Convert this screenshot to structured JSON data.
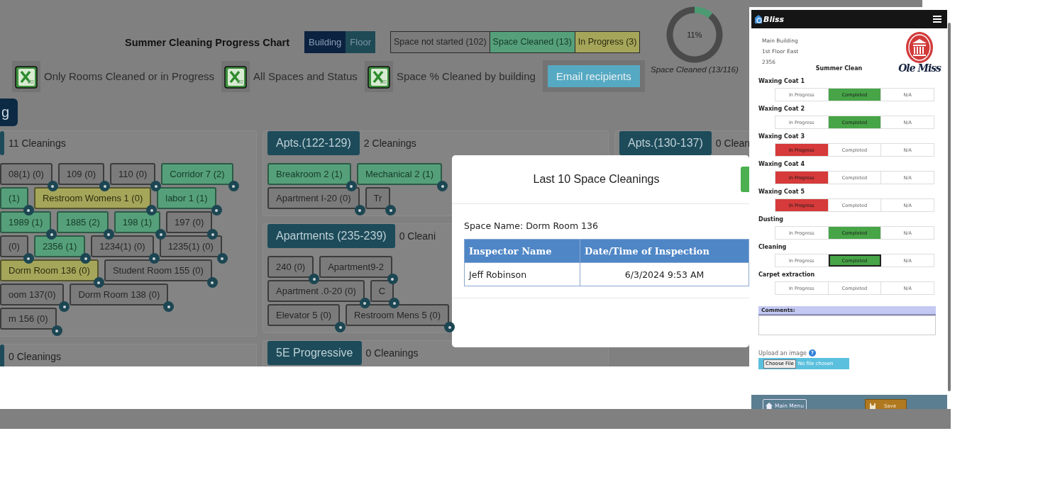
{
  "header": {
    "title": "Summer Cleaning Progress Chart",
    "view_toggle": [
      {
        "label": "Building",
        "selected": true
      },
      {
        "label": "Floor",
        "selected": false
      }
    ],
    "legend": [
      {
        "label": "Space not started (102)",
        "kind": "not_started"
      },
      {
        "label": "Space Cleaned (13)",
        "kind": "cleaned"
      },
      {
        "label": "In Progress (3)",
        "kind": "in_progress"
      }
    ],
    "progress": {
      "label": "11%",
      "caption": "Space Cleaned (13/116)",
      "chart_data": {
        "type": "donut",
        "values": [
          11,
          89
        ]
      }
    }
  },
  "exports": [
    {
      "label": "Only Rooms Cleaned or in Progress"
    },
    {
      "label": "All Spaces and Status"
    },
    {
      "label": "Space % Cleaned by building"
    }
  ],
  "email_button": "Email recipients",
  "building_tab": "g",
  "columns": [
    {
      "panels": [
        {
          "count": "11 Cleanings",
          "lines": [
            {
              "rooms": [
                {
                  "label": "08(1) (0)",
                  "kind": "not_started"
                },
                {
                  "label": "109 (0)",
                  "kind": "not_started"
                },
                {
                  "label": "110 (0)",
                  "kind": "not_started"
                },
                {
                  "label": "Corridor 7 (2)",
                  "kind": "cleaned"
                }
              ]
            },
            {
              "rooms": [
                {
                  "label": "(1)",
                  "kind": "cleaned"
                },
                {
                  "label": "Restroom Womens 1 (0)",
                  "kind": "in_progress"
                },
                {
                  "label": "labor 1 (1)",
                  "kind": "cleaned"
                }
              ]
            },
            {
              "rooms": [
                {
                  "label": "1989 (1)",
                  "kind": "cleaned"
                },
                {
                  "label": "1885 (2)",
                  "kind": "cleaned"
                },
                {
                  "label": "198 (1)",
                  "kind": "cleaned"
                },
                {
                  "label": "197 (0)",
                  "kind": "not_started"
                }
              ]
            },
            {
              "rooms": [
                {
                  "label": "(0)",
                  "kind": "not_started"
                },
                {
                  "label": "2356 (1)",
                  "kind": "cleaned"
                },
                {
                  "label": "1234(1) (0)",
                  "kind": "not_started"
                },
                {
                  "label": "1235(1) (0)",
                  "kind": "not_started"
                }
              ]
            },
            {
              "rooms": [
                {
                  "label": "Dorm Room 136 (0)",
                  "kind": "in_progress"
                },
                {
                  "label": "Student Room 155 (0)",
                  "kind": "not_started"
                }
              ]
            },
            {
              "rooms": [
                {
                  "label": "oom 137(0)",
                  "kind": "not_started"
                },
                {
                  "label": "Dorm Room 138 (0)",
                  "kind": "not_started"
                }
              ]
            },
            {
              "rooms": [
                {
                  "label": "m 156 (0)",
                  "kind": "not_started"
                }
              ]
            }
          ]
        },
        {
          "count": "0 Cleanings"
        }
      ]
    },
    {
      "panels": [
        {
          "title": "Apts.(122-129)",
          "count": "2 Cleanings",
          "lines": [
            {
              "rooms": [
                {
                  "label": "Breakroom 2 (1)",
                  "kind": "cleaned"
                },
                {
                  "label": "Mechanical 2 (1)",
                  "kind": "cleaned"
                }
              ]
            },
            {
              "rooms": [
                {
                  "label": "Apartment I-20 (0)",
                  "kind": "not_started"
                },
                {
                  "label": "Tr",
                  "kind": "not_started"
                }
              ]
            }
          ]
        },
        {
          "title": "Apartments (235-239)",
          "count": "0 Cleani",
          "lines": [
            {
              "rooms": [
                {
                  "label": "240 (0)",
                  "kind": "not_started"
                },
                {
                  "label": "Apartment9-2",
                  "kind": "not_started"
                }
              ]
            },
            {
              "rooms": [
                {
                  "label": "Apartment .0-20 (0)",
                  "kind": "not_started"
                },
                {
                  "label": "C",
                  "kind": "not_started"
                }
              ]
            },
            {
              "rooms": [
                {
                  "label": "Elevator 5 (0)",
                  "kind": "not_started"
                },
                {
                  "label": "Restroom Mens 5 (0)",
                  "kind": "not_started"
                }
              ]
            }
          ]
        },
        {
          "title": "5E Progressive",
          "count": "0 Cleanings"
        }
      ]
    },
    {
      "panels": [
        {
          "title": "Apts.(130-137)",
          "count": "0 Clean"
        }
      ]
    }
  ],
  "modal": {
    "title": "Last 10 Space Cleanings",
    "space_label": "Space Name:",
    "space_name": "Dorm Room 136",
    "table": {
      "columns": [
        "Inspector Name",
        "Date/Time of Inspection"
      ],
      "rows": [
        [
          "Jeff Robinson",
          "6/3/2024 9:53 AM"
        ]
      ]
    }
  },
  "phone": {
    "app_name": "Bliss",
    "address": [
      "Main Building",
      "1st Floor East",
      "2356"
    ],
    "logo_text": "Ole Miss",
    "form_title": "Summer Clean",
    "tasks": [
      {
        "name": "Waxing Coat 1",
        "focused": false,
        "options": [
          {
            "label": "In Progress",
            "kind": "in_progress",
            "selected": false
          },
          {
            "label": "Completed",
            "kind": "completed",
            "selected": true
          },
          {
            "label": "N/A",
            "kind": "na",
            "selected": false
          }
        ]
      },
      {
        "name": "Waxing Coat 2",
        "focused": false,
        "options": [
          {
            "label": "In Progress",
            "kind": "in_progress",
            "selected": false
          },
          {
            "label": "Completed",
            "kind": "completed",
            "selected": true
          },
          {
            "label": "N/A",
            "kind": "na",
            "selected": false
          }
        ]
      },
      {
        "name": "Waxing Coat 3",
        "focused": false,
        "options": [
          {
            "label": "In Progress",
            "kind": "in_progress",
            "selected": true
          },
          {
            "label": "Completed",
            "kind": "completed",
            "selected": false
          },
          {
            "label": "N/A",
            "kind": "na",
            "selected": false
          }
        ]
      },
      {
        "name": "Waxing Coat 4",
        "focused": false,
        "options": [
          {
            "label": "In Progress",
            "kind": "in_progress",
            "selected": true
          },
          {
            "label": "Completed",
            "kind": "completed",
            "selected": false
          },
          {
            "label": "N/A",
            "kind": "na",
            "selected": false
          }
        ]
      },
      {
        "name": "Waxing Coat 5",
        "focused": false,
        "options": [
          {
            "label": "In Progress",
            "kind": "in_progress",
            "selected": true
          },
          {
            "label": "Completed",
            "kind": "completed",
            "selected": false
          },
          {
            "label": "N/A",
            "kind": "na",
            "selected": false
          }
        ]
      },
      {
        "name": "Dusting",
        "focused": false,
        "options": [
          {
            "label": "In Progress",
            "kind": "in_progress",
            "selected": false
          },
          {
            "label": "Completed",
            "kind": "completed",
            "selected": true
          },
          {
            "label": "N/A",
            "kind": "na",
            "selected": false
          }
        ]
      },
      {
        "name": "Cleaning",
        "focused": true,
        "options": [
          {
            "label": "In Progress",
            "kind": "in_progress",
            "selected": false
          },
          {
            "label": "Completed",
            "kind": "completed",
            "selected": true
          },
          {
            "label": "N/A",
            "kind": "na",
            "selected": false
          }
        ]
      },
      {
        "name": "Carpet extraction",
        "focused": false,
        "options": [
          {
            "label": "In Progress",
            "kind": "in_progress",
            "selected": false
          },
          {
            "label": "Completed",
            "kind": "completed",
            "selected": false
          },
          {
            "label": "N/A",
            "kind": "na",
            "selected": false
          }
        ]
      }
    ],
    "comments_label": "Comments:",
    "upload_label": "Upload an image",
    "help_icon": "?",
    "file_button": "Choose File",
    "file_status": "No file chosen",
    "main_menu": "Main Menu",
    "save": "Save"
  }
}
